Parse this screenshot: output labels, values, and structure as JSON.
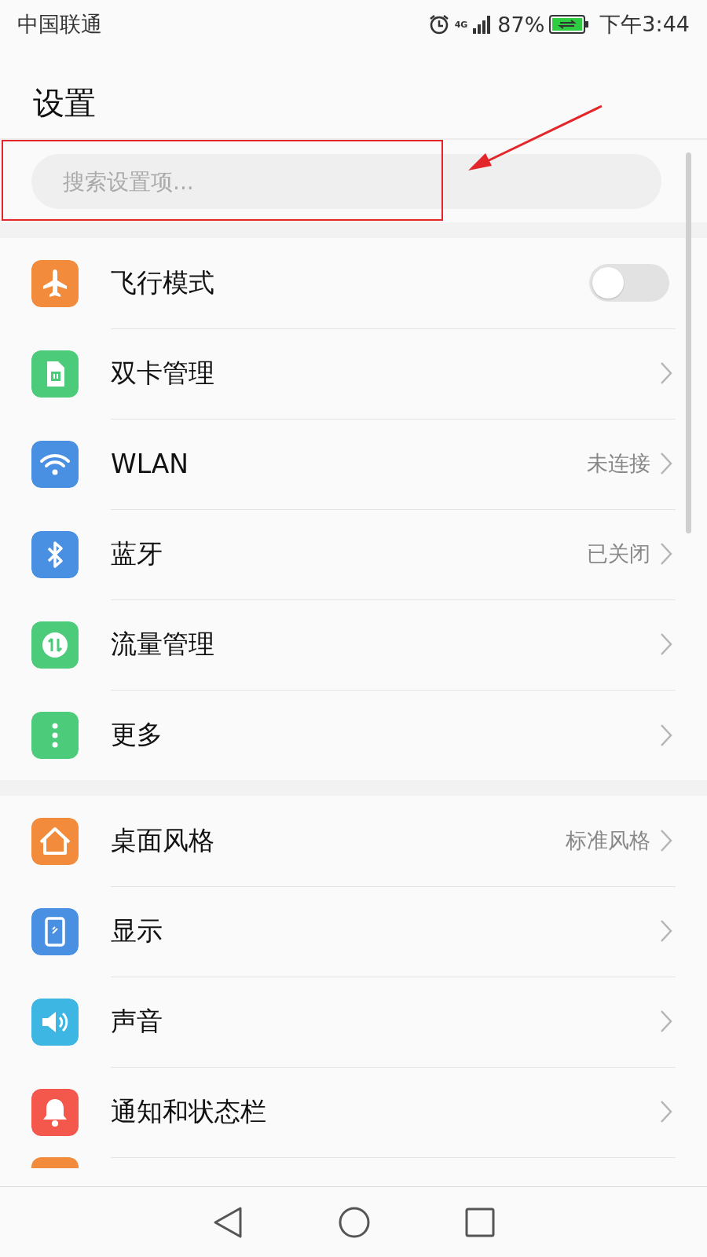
{
  "status_bar": {
    "carrier": "中国联通",
    "network": "4G",
    "battery": "87%",
    "time": "下午3:44"
  },
  "title": "设置",
  "search": {
    "placeholder": "搜索设置项..."
  },
  "groups": [
    {
      "items": [
        {
          "kind": "toggle",
          "label": "飞行模式",
          "color": "#f28b3b",
          "on": false
        },
        {
          "kind": "link",
          "label": "双卡管理",
          "color": "#4ccb7b"
        },
        {
          "kind": "link",
          "label": "WLAN",
          "color": "#4a90e2",
          "value": "未连接"
        },
        {
          "kind": "link",
          "label": "蓝牙",
          "color": "#4a90e2",
          "value": "已关闭"
        },
        {
          "kind": "link",
          "label": "流量管理",
          "color": "#4ccb7b"
        },
        {
          "kind": "link",
          "label": "更多",
          "color": "#4ccb7b"
        }
      ]
    },
    {
      "items": [
        {
          "kind": "link",
          "label": "桌面风格",
          "color": "#f28b3b",
          "value": "标准风格"
        },
        {
          "kind": "link",
          "label": "显示",
          "color": "#4a90e2"
        },
        {
          "kind": "link",
          "label": "声音",
          "color": "#3db6e3"
        },
        {
          "kind": "link",
          "label": "通知和状态栏",
          "color": "#f4574b"
        },
        {
          "kind": "cut",
          "color": "#f28b3b"
        }
      ]
    }
  ]
}
